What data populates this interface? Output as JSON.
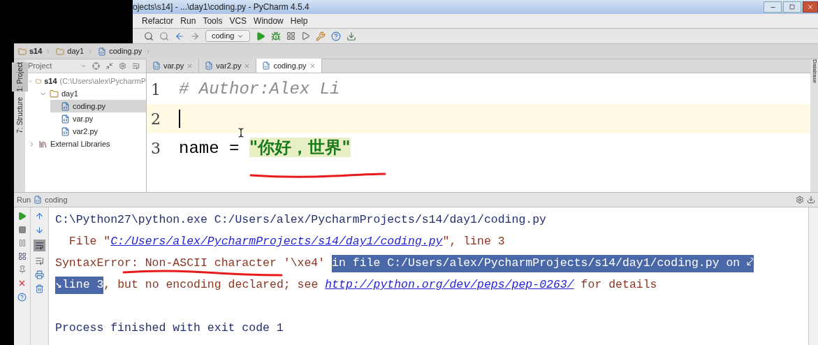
{
  "title_bar": {
    "title": "ojects\\s14] - ...\\day1\\coding.py - PyCharm 4.5.4"
  },
  "menu": [
    "Refactor",
    "Run",
    "Tools",
    "VCS",
    "Window",
    "Help"
  ],
  "toolbar": {
    "run_config": "coding"
  },
  "breadcrumbs": [
    "s14",
    "day1",
    "coding.py"
  ],
  "tool_strip": [
    {
      "label": "1: Project",
      "selected": true
    },
    {
      "label": "7: Structure",
      "selected": false
    }
  ],
  "project_panel": {
    "title": "Project",
    "tree": [
      {
        "label": "s14",
        "path": "(C:\\Users\\alex\\PycharmP",
        "kind": "folder",
        "expanded": true,
        "selected": false,
        "children": [
          {
            "label": "day1",
            "kind": "folder",
            "expanded": true,
            "selected": false,
            "children": [
              {
                "label": "coding.py",
                "kind": "file",
                "selected": true
              },
              {
                "label": "var.py",
                "kind": "file",
                "selected": false
              },
              {
                "label": "var2.py",
                "kind": "file",
                "selected": false
              }
            ]
          }
        ]
      },
      {
        "label": "External Libraries",
        "kind": "library",
        "expanded": false,
        "selected": false
      }
    ]
  },
  "tabs": [
    {
      "label": "var.py",
      "selected": false
    },
    {
      "label": "var2.py",
      "selected": false
    },
    {
      "label": "coding.py",
      "selected": true
    }
  ],
  "editor": {
    "lines": [
      {
        "number": "1",
        "current": false,
        "tokens": [
          {
            "kind": "comment",
            "text": "# Author:Alex Li"
          }
        ]
      },
      {
        "number": "2",
        "current": true
      },
      {
        "number": "3",
        "current": false,
        "tokens": [
          {
            "kind": "plain",
            "text": "name = "
          },
          {
            "kind": "string",
            "text": "\"你好，世界\""
          }
        ]
      }
    ]
  },
  "right_strip": {
    "label": "Database"
  },
  "run_panel": {
    "title": "Run",
    "config": "coding",
    "lines": [
      {
        "kind": "output",
        "segments": [
          {
            "kind": "normal",
            "text": "C:\\Python27\\python.exe C:/Users/alex/PycharmProjects/s14/day1/coding.py"
          }
        ]
      },
      {
        "kind": "output",
        "segments": [
          {
            "kind": "error",
            "text": "  File \""
          },
          {
            "kind": "link",
            "text": "C:/Users/alex/PycharmProjects/s14/day1/coding.py"
          },
          {
            "kind": "error",
            "text": "\", line 3"
          }
        ]
      },
      {
        "kind": "output",
        "segments": [
          {
            "kind": "error",
            "text": "SyntaxError: Non-ASCII character '\\xe4' "
          },
          {
            "kind": "selected",
            "text": "in file C:/Users/alex/PycharmProjects/s14/day1/coding.py on ⤦"
          }
        ]
      },
      {
        "kind": "output",
        "segments": [
          {
            "kind": "selected",
            "text": "↘line 3"
          },
          {
            "kind": "error",
            "text": ", but no encoding declared; see "
          },
          {
            "kind": "link",
            "text": "http://python.org/dev/peps/pep-0263/"
          },
          {
            "kind": "error",
            "text": " for details"
          }
        ]
      },
      {
        "kind": "status",
        "segments": [
          {
            "kind": "normal",
            "text": "Process finished with exit code 1"
          }
        ]
      }
    ]
  }
}
